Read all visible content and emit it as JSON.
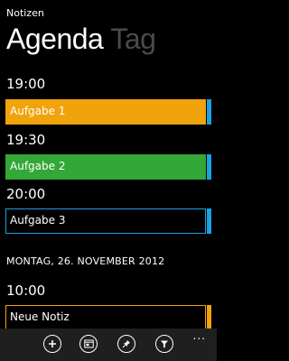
{
  "app_title": "Notizen",
  "pivot": {
    "active": "Agenda",
    "inactive": "Tag"
  },
  "agenda": {
    "times": [
      "19:00",
      "19:30",
      "20:00"
    ],
    "items": [
      {
        "label": "Aufgabe 1",
        "style": "filled",
        "color": "#f0a30a",
        "bar_color": "#1ba1e2"
      },
      {
        "label": "Aufgabe 2",
        "style": "filled",
        "color": "#33a737",
        "bar_color": "#1ba1e2"
      },
      {
        "label": "Aufgabe 3",
        "style": "outline",
        "color": "#1ba1e2",
        "bar_color": "#1ba1e2"
      }
    ],
    "date_heading": "MONTAG, 26. NOVEMBER 2012",
    "next_time": "10:00",
    "next_item": {
      "label": "Neue Notiz",
      "style": "outline",
      "color": "#f0a30a",
      "bar_color": "#f0a30a"
    }
  },
  "appbar": {
    "buttons": [
      "add-icon",
      "calendar-icon",
      "pin-icon",
      "filter-icon"
    ],
    "more": "..."
  },
  "colors": {
    "background": "#000000",
    "accent_blue": "#1ba1e2",
    "orange": "#f0a30a",
    "green": "#33a737",
    "appbar": "#1f1f1f"
  }
}
